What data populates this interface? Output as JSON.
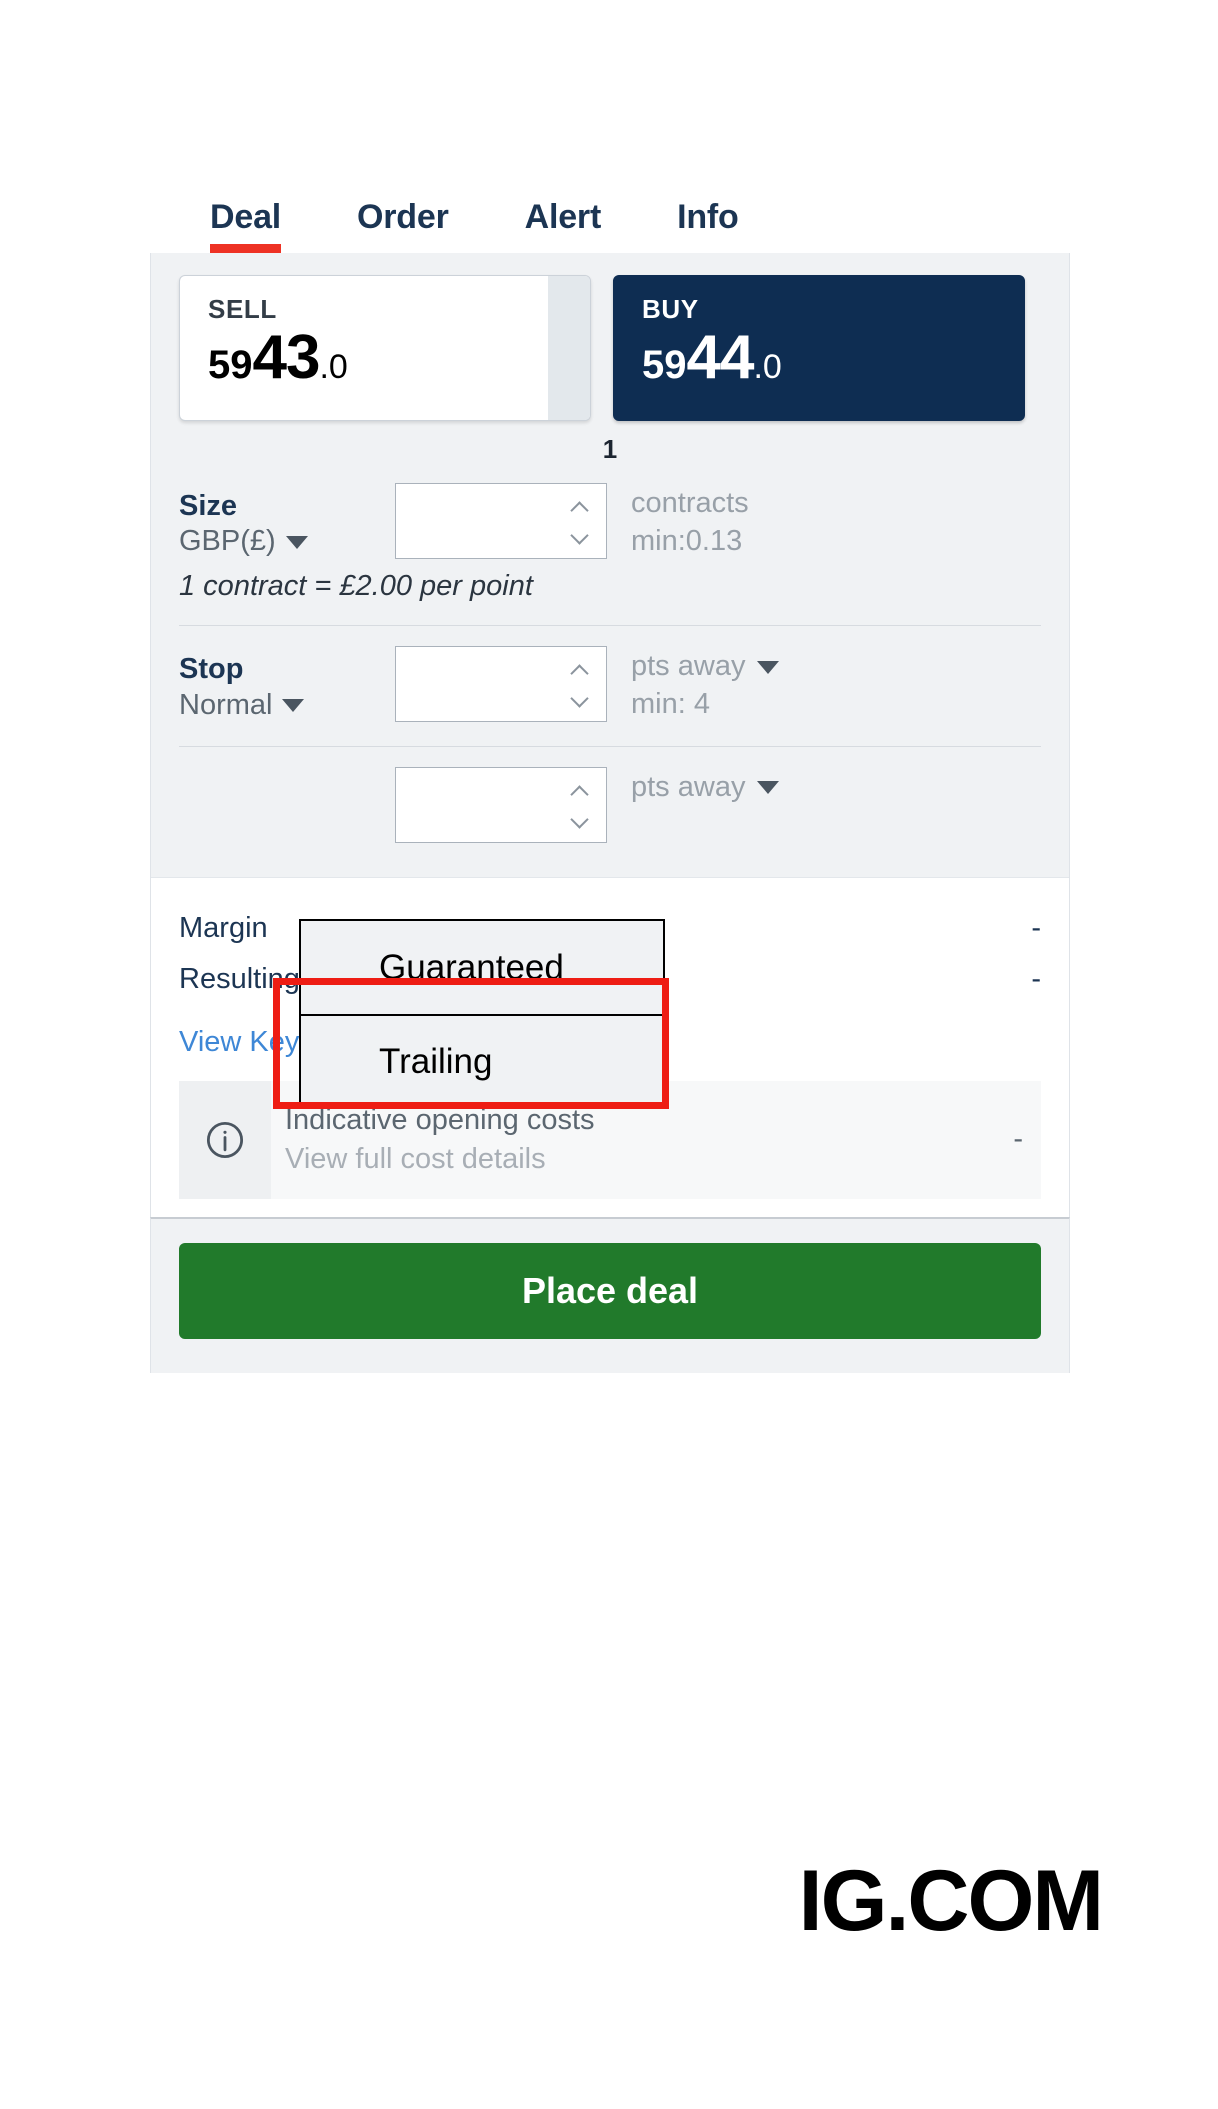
{
  "tabs": [
    {
      "label": "Deal",
      "active": true
    },
    {
      "label": "Order",
      "active": false
    },
    {
      "label": "Alert",
      "active": false
    },
    {
      "label": "Info",
      "active": false
    }
  ],
  "prices": {
    "sell": {
      "label": "SELL",
      "prefix": "59",
      "big": "43",
      "decimal": ".0",
      "full": "5943.0"
    },
    "buy": {
      "label": "BUY",
      "prefix": "59",
      "big": "44",
      "decimal": ".0",
      "full": "5944.0"
    },
    "spread": "1"
  },
  "size": {
    "title": "Size",
    "currency": "GBP(£)",
    "value": "",
    "placeholder": "",
    "unit": "contracts",
    "min": "min:0.13",
    "note": "1 contract = £2.00 per point"
  },
  "stop": {
    "title": "Stop",
    "type": "Normal",
    "value": "",
    "placeholder": "",
    "unit": "pts away",
    "min": "min: 4",
    "options": [
      "Guaranteed",
      "Trailing"
    ]
  },
  "limit": {
    "value": "",
    "placeholder": "",
    "unit": "pts away"
  },
  "summary": {
    "margin_label": "Margin",
    "margin_value": "-",
    "position_label": "Resulting position",
    "position_value": "-",
    "kid_link": "View Key Information Document",
    "costs_title": "Indicative opening costs",
    "costs_link": "View full cost details",
    "costs_value": "-"
  },
  "cta": {
    "label": "Place deal"
  },
  "brand": {
    "text": "IG.COM"
  },
  "colors": {
    "accent_red": "#ee3224",
    "buy_navy": "#0e2d52",
    "cta_green": "#217a2b",
    "link_blue": "#3e87d6",
    "highlight_red": "#ee1d14"
  }
}
